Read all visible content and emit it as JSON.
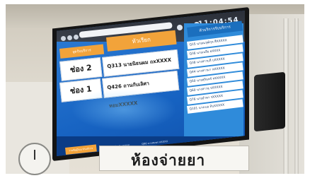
{
  "tv": {
    "clock": "11:04:54",
    "center_header": "หัวเรียก",
    "left_header": "จุดรับบริการ",
    "right_header": "หัวบริการรับบริการ",
    "counters": [
      {
        "counter": "ช่อง 2",
        "queue": "Q313 นายนิธนผม ถxXXXX"
      },
      {
        "counter": "ช่อง 1",
        "queue": "Q426 ถานกับเลิศา หอมXXXXX"
      }
    ],
    "waiting_list": [
      "Q15 นายณวุฒิกุล สีXXXXX",
      "Q36 นายเบลีย ฮXXXX",
      "Q38 นางสาวบลี บXXXXX",
      "Q44 นางสาวมา หXXXXX",
      "Q50 นายสุรินทร์ หXXXXX",
      "Q60 นางสาวจุ จXXXXX",
      "Q76 นายอำพา รXXXXX",
      "Q101 นางเบอ ทิบXXXXX"
    ],
    "ticker_label": "รายชื่อผู้ไม่มารับบริการ",
    "ticker_items": [
      "Q323 นายสุพัฒน์ มXXXX",
      "Q90 นางสมพร ทXXXX"
    ]
  },
  "sign": {
    "text": "ห้องจ่ายยา"
  },
  "colors": {
    "screen_blue": "#1763c2",
    "accent_orange": "#f2a33a",
    "panel_blue": "#2f8bda"
  }
}
